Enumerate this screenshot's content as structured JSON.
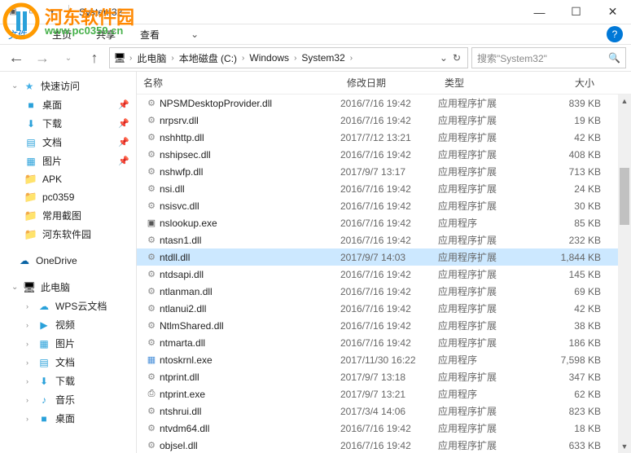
{
  "window": {
    "title": "System32"
  },
  "ribbon": {
    "file": "文件",
    "home": "主页",
    "share": "共享",
    "view": "查看"
  },
  "watermark": {
    "text": "河东软件园",
    "url": "www.pc0359.cn"
  },
  "breadcrumb": {
    "items": [
      "此电脑",
      "本地磁盘 (C:)",
      "Windows",
      "System32"
    ]
  },
  "search": {
    "placeholder": "搜索\"System32\""
  },
  "sidebar": {
    "quick": {
      "label": "快速访问",
      "items": [
        {
          "label": "桌面",
          "icon": "ic-desktop",
          "pin": true
        },
        {
          "label": "下载",
          "icon": "ic-download",
          "pin": true
        },
        {
          "label": "文档",
          "icon": "ic-doc",
          "pin": true
        },
        {
          "label": "图片",
          "icon": "ic-pic",
          "pin": true
        },
        {
          "label": "APK",
          "icon": "ic-folder"
        },
        {
          "label": "pc0359",
          "icon": "ic-folder"
        },
        {
          "label": "常用截图",
          "icon": "ic-folder"
        },
        {
          "label": "河东软件园",
          "icon": "ic-folder"
        }
      ]
    },
    "onedrive": {
      "label": "OneDrive"
    },
    "pc": {
      "label": "此电脑",
      "items": [
        {
          "label": "WPS云文档",
          "icon": "ic-wps",
          "caret": true
        },
        {
          "label": "视频",
          "icon": "ic-video",
          "caret": true
        },
        {
          "label": "图片",
          "icon": "ic-pic",
          "caret": true
        },
        {
          "label": "文档",
          "icon": "ic-doc",
          "caret": true
        },
        {
          "label": "下载",
          "icon": "ic-download",
          "caret": true
        },
        {
          "label": "音乐",
          "icon": "ic-music",
          "caret": true
        },
        {
          "label": "桌面",
          "icon": "ic-desktop",
          "caret": true
        }
      ]
    }
  },
  "columns": {
    "name": "名称",
    "date": "修改日期",
    "type": "类型",
    "size": "大小"
  },
  "files": [
    {
      "name": "NPSMDesktopProvider.dll",
      "date": "2016/7/16 19:42",
      "type": "应用程序扩展",
      "size": "839 KB",
      "icon": "ic-dll"
    },
    {
      "name": "nrpsrv.dll",
      "date": "2016/7/16 19:42",
      "type": "应用程序扩展",
      "size": "19 KB",
      "icon": "ic-dll"
    },
    {
      "name": "nshhttp.dll",
      "date": "2017/7/12 13:21",
      "type": "应用程序扩展",
      "size": "42 KB",
      "icon": "ic-dll"
    },
    {
      "name": "nshipsec.dll",
      "date": "2016/7/16 19:42",
      "type": "应用程序扩展",
      "size": "408 KB",
      "icon": "ic-dll"
    },
    {
      "name": "nshwfp.dll",
      "date": "2017/9/7 13:17",
      "type": "应用程序扩展",
      "size": "713 KB",
      "icon": "ic-dll"
    },
    {
      "name": "nsi.dll",
      "date": "2016/7/16 19:42",
      "type": "应用程序扩展",
      "size": "24 KB",
      "icon": "ic-dll"
    },
    {
      "name": "nsisvc.dll",
      "date": "2016/7/16 19:42",
      "type": "应用程序扩展",
      "size": "30 KB",
      "icon": "ic-dll"
    },
    {
      "name": "nslookup.exe",
      "date": "2016/7/16 19:42",
      "type": "应用程序",
      "size": "85 KB",
      "icon": "ic-exe"
    },
    {
      "name": "ntasn1.dll",
      "date": "2016/7/16 19:42",
      "type": "应用程序扩展",
      "size": "232 KB",
      "icon": "ic-dll"
    },
    {
      "name": "ntdll.dll",
      "date": "2017/9/7 14:03",
      "type": "应用程序扩展",
      "size": "1,844 KB",
      "icon": "ic-dll",
      "selected": true
    },
    {
      "name": "ntdsapi.dll",
      "date": "2016/7/16 19:42",
      "type": "应用程序扩展",
      "size": "145 KB",
      "icon": "ic-dll"
    },
    {
      "name": "ntlanman.dll",
      "date": "2016/7/16 19:42",
      "type": "应用程序扩展",
      "size": "69 KB",
      "icon": "ic-dll"
    },
    {
      "name": "ntlanui2.dll",
      "date": "2016/7/16 19:42",
      "type": "应用程序扩展",
      "size": "42 KB",
      "icon": "ic-dll"
    },
    {
      "name": "NtlmShared.dll",
      "date": "2016/7/16 19:42",
      "type": "应用程序扩展",
      "size": "38 KB",
      "icon": "ic-dll"
    },
    {
      "name": "ntmarta.dll",
      "date": "2016/7/16 19:42",
      "type": "应用程序扩展",
      "size": "186 KB",
      "icon": "ic-dll"
    },
    {
      "name": "ntoskrnl.exe",
      "date": "2017/11/30 16:22",
      "type": "应用程序",
      "size": "7,598 KB",
      "icon": "ic-exe2"
    },
    {
      "name": "ntprint.dll",
      "date": "2017/9/7 13:18",
      "type": "应用程序扩展",
      "size": "347 KB",
      "icon": "ic-dll"
    },
    {
      "name": "ntprint.exe",
      "date": "2017/9/7 13:21",
      "type": "应用程序",
      "size": "62 KB",
      "icon": "ic-print"
    },
    {
      "name": "ntshrui.dll",
      "date": "2017/3/4 14:06",
      "type": "应用程序扩展",
      "size": "823 KB",
      "icon": "ic-dll"
    },
    {
      "name": "ntvdm64.dll",
      "date": "2016/7/16 19:42",
      "type": "应用程序扩展",
      "size": "18 KB",
      "icon": "ic-dll"
    },
    {
      "name": "objsel.dll",
      "date": "2016/7/16 19:42",
      "type": "应用程序扩展",
      "size": "633 KB",
      "icon": "ic-dll"
    }
  ]
}
